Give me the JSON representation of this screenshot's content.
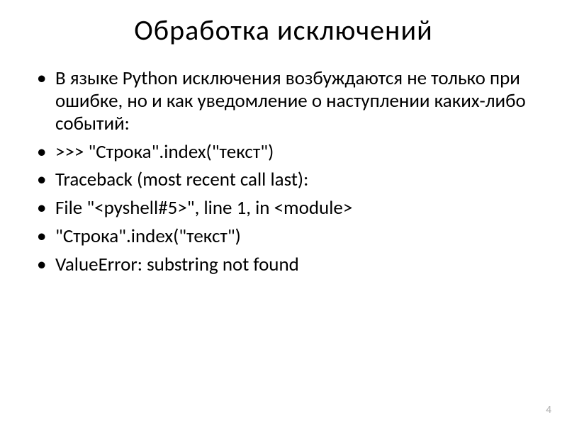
{
  "slide": {
    "title": "Обработка  исключений",
    "bullets": [
      "В языке Python исключения возбуждаются не только  при  ошибке,  но  и  как уведомление  о наступлении  каких-либо  событий:",
      ">>>  \"Строка\".index(\"текст\")",
      "Traceback  (most  recent  call  last):",
      "  File  \"<pyshell#5>\",  line  1,  in <module>",
      "    \"Строка\".index(\"текст\")",
      "ValueError:  substring  not  found"
    ],
    "page_number": "4"
  }
}
